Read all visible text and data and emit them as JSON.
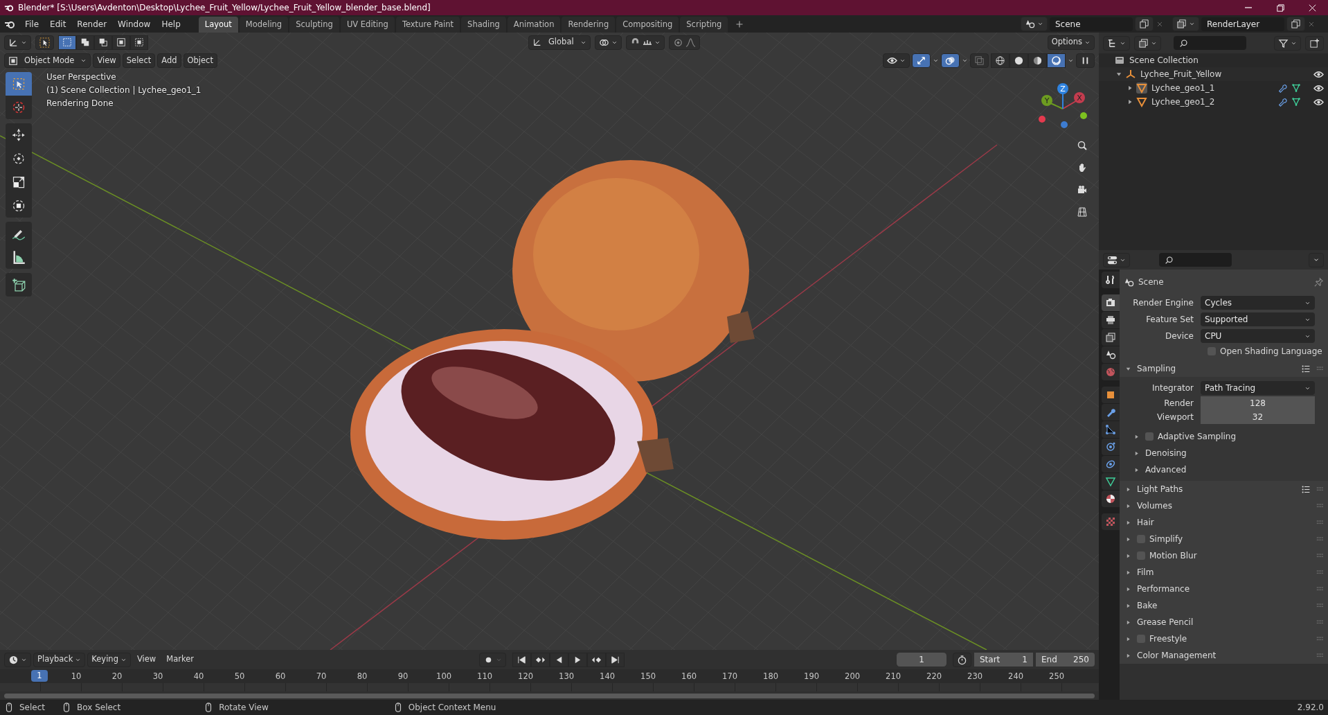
{
  "window": {
    "title": "Blender* [S:\\Users\\Avdenton\\Desktop\\Lychee_Fruit_Yellow/Lychee_Fruit_Yellow_blender_base.blend]"
  },
  "menu": [
    "File",
    "Edit",
    "Render",
    "Window",
    "Help"
  ],
  "workspaces": [
    {
      "label": "Layout",
      "selected": true
    },
    {
      "label": "Modeling",
      "selected": false
    },
    {
      "label": "Sculpting",
      "selected": false
    },
    {
      "label": "UV Editing",
      "selected": false
    },
    {
      "label": "Texture Paint",
      "selected": false
    },
    {
      "label": "Shading",
      "selected": false
    },
    {
      "label": "Animation",
      "selected": false
    },
    {
      "label": "Rendering",
      "selected": false
    },
    {
      "label": "Compositing",
      "selected": false
    },
    {
      "label": "Scripting",
      "selected": false
    }
  ],
  "scene_selector": {
    "value": "Scene"
  },
  "view_layer_selector": {
    "value": "RenderLayer"
  },
  "viewport": {
    "tool_header": {
      "select_modes": [
        {
          "selected": true
        },
        {
          "selected": false
        },
        {
          "selected": false
        },
        {
          "selected": false
        },
        {
          "selected": false
        }
      ],
      "orientation": "Global",
      "options": "Options"
    },
    "header": {
      "mode": "Object Mode",
      "menus": [
        "View",
        "Select",
        "Add",
        "Object"
      ]
    },
    "shading_modes": [
      {
        "kind": "wireframe",
        "selected": false
      },
      {
        "kind": "solid",
        "selected": false
      },
      {
        "kind": "material",
        "selected": false
      },
      {
        "kind": "rendered",
        "selected": true
      }
    ],
    "overlay_text": [
      "User Perspective",
      "(1) Scene Collection | Lychee_geo1_1",
      "Rendering Done"
    ],
    "tools": [
      {
        "kind": "select",
        "selected": true
      },
      {
        "kind": "cursor",
        "selected": false
      },
      {
        "kind": "move",
        "selected": false
      },
      {
        "kind": "rotate",
        "selected": false
      },
      {
        "kind": "scale",
        "selected": false
      },
      {
        "kind": "transform",
        "selected": false
      },
      {
        "kind": "annotate",
        "selected": false
      },
      {
        "kind": "measure",
        "selected": false
      },
      {
        "kind": "add_cube",
        "selected": false
      }
    ],
    "gizmo": {
      "axes": [
        "Y",
        "Z",
        "X"
      ]
    }
  },
  "outliner": {
    "items": [
      {
        "label": "Scene Collection",
        "kind": "collection",
        "children": [
          {
            "label": "Lychee_Fruit_Yellow",
            "kind": "empty",
            "expanded": true,
            "children": [
              {
                "label": "Lychee_geo1_1",
                "kind": "mesh",
                "expanded": false,
                "active": true
              },
              {
                "label": "Lychee_geo1_2",
                "kind": "mesh",
                "expanded": false,
                "active": false
              }
            ]
          }
        ]
      }
    ]
  },
  "properties": {
    "tabs": [
      {
        "kind": "tool",
        "selected": false
      },
      {
        "kind": "render",
        "selected": true
      },
      {
        "kind": "output",
        "selected": false
      },
      {
        "kind": "view_layer",
        "selected": false
      },
      {
        "kind": "scene",
        "selected": false
      },
      {
        "kind": "world",
        "selected": false
      },
      {
        "kind": "object",
        "selected": false
      },
      {
        "kind": "modifiers",
        "selected": false
      },
      {
        "kind": "particles",
        "selected": false
      },
      {
        "kind": "physics",
        "selected": false
      },
      {
        "kind": "constraints",
        "selected": false
      },
      {
        "kind": "data",
        "selected": false
      },
      {
        "kind": "material",
        "selected": false
      },
      {
        "kind": "texture",
        "selected": false
      }
    ],
    "context": "Scene",
    "fields": [
      {
        "label": "Render Engine",
        "value": "Cycles",
        "kind": "dropdown"
      },
      {
        "label": "Feature Set",
        "value": "Supported",
        "kind": "dropdown"
      },
      {
        "label": "Device",
        "value": "CPU",
        "kind": "dropdown"
      },
      {
        "label": "Open Shading Language",
        "checked": false,
        "kind": "checkbox"
      }
    ],
    "panels": [
      {
        "title": "Sampling",
        "expanded": true,
        "presets": true,
        "fields": [
          {
            "label": "Integrator",
            "value": "Path Tracing",
            "kind": "dropdown"
          },
          {
            "label": "Render",
            "value": "128",
            "kind": "number"
          },
          {
            "label": "Viewport",
            "value": "32",
            "kind": "number"
          }
        ],
        "subpanels": [
          {
            "title": "Adaptive Sampling",
            "expanded": false,
            "checked": false
          },
          {
            "title": "Denoising",
            "expanded": false
          },
          {
            "title": "Advanced",
            "expanded": false
          }
        ]
      },
      {
        "title": "Light Paths",
        "expanded": false,
        "presets": true
      },
      {
        "title": "Volumes",
        "expanded": false,
        "presets": false
      },
      {
        "title": "Hair",
        "expanded": false,
        "presets": false
      },
      {
        "title": "Simplify",
        "expanded": false,
        "presets": false,
        "checked": false
      },
      {
        "title": "Motion Blur",
        "expanded": false,
        "presets": false,
        "checked": false
      },
      {
        "title": "Film",
        "expanded": false,
        "presets": false
      },
      {
        "title": "Performance",
        "expanded": false,
        "presets": false
      },
      {
        "title": "Bake",
        "expanded": false,
        "presets": false
      },
      {
        "title": "Grease Pencil",
        "expanded": false,
        "presets": false
      },
      {
        "title": "Freestyle",
        "expanded": false,
        "presets": false,
        "checked": false
      },
      {
        "title": "Color Management",
        "expanded": false,
        "presets": false
      }
    ]
  },
  "timeline": {
    "menus": [
      "Playback",
      "Keying",
      "View",
      "Marker"
    ],
    "current_frame": "1",
    "start_label": "Start",
    "start": "1",
    "end_label": "End",
    "end": "250",
    "playhead": "1",
    "ruler": [
      "10",
      "20",
      "30",
      "40",
      "50",
      "60",
      "70",
      "80",
      "90",
      "100",
      "110",
      "120",
      "130",
      "140",
      "150",
      "160",
      "170",
      "180",
      "190",
      "200",
      "210",
      "220",
      "230",
      "240",
      "250"
    ]
  },
  "status_bar": {
    "hints": [
      "Select",
      "Box Select",
      "Rotate View",
      "Object Context Menu"
    ],
    "version": "2.92.0"
  }
}
